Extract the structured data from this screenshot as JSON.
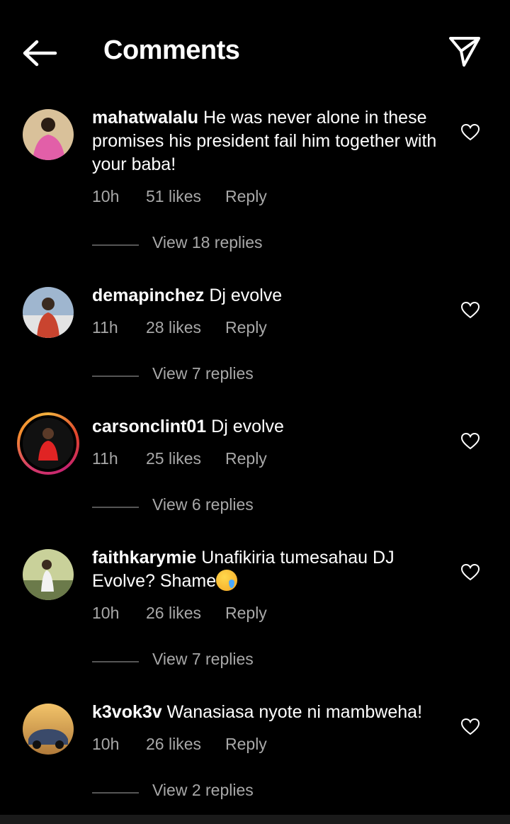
{
  "header": {
    "title": "Comments",
    "back_icon": "arrow-left-icon",
    "send_icon": "paper-plane-icon"
  },
  "comments": [
    {
      "username": "mahatwalalu",
      "text": "He was never alone in these promises his president fail him together with your baba!",
      "time": "10h",
      "likes": "51 likes",
      "reply": "Reply",
      "view_replies": "View 18 replies",
      "avatar_colors": [
        "#d9c19a",
        "#e25fa8"
      ]
    },
    {
      "username": "demapinchez",
      "text": "Dj evolve",
      "time": "11h",
      "likes": "28 likes",
      "reply": "Reply",
      "view_replies": "View 7 replies",
      "avatar_colors": [
        "#9fb6cf",
        "#c9442f"
      ]
    },
    {
      "username": "carsonclint01",
      "text": "Dj evolve",
      "time": "11h",
      "likes": "25 likes",
      "reply": "Reply",
      "view_replies": "View 6 replies",
      "avatar_colors": [
        "#111111",
        "#e02424"
      ]
    },
    {
      "username": "faithkarymie",
      "text": "Unafikiria tumesahau DJ Evolve? Shame",
      "time": "10h",
      "likes": "26 likes",
      "reply": "Reply",
      "view_replies": "View 7 replies",
      "avatar_colors": [
        "#c9d19a",
        "#6b7a4a"
      ]
    },
    {
      "username": "k3vok3v",
      "text": "Wanasiasa nyote ni mambweha!",
      "time": "10h",
      "likes": "26 likes",
      "reply": "Reply",
      "view_replies": "View 2 replies",
      "avatar_colors": [
        "#e9b25a",
        "#3a4a6a"
      ]
    }
  ]
}
